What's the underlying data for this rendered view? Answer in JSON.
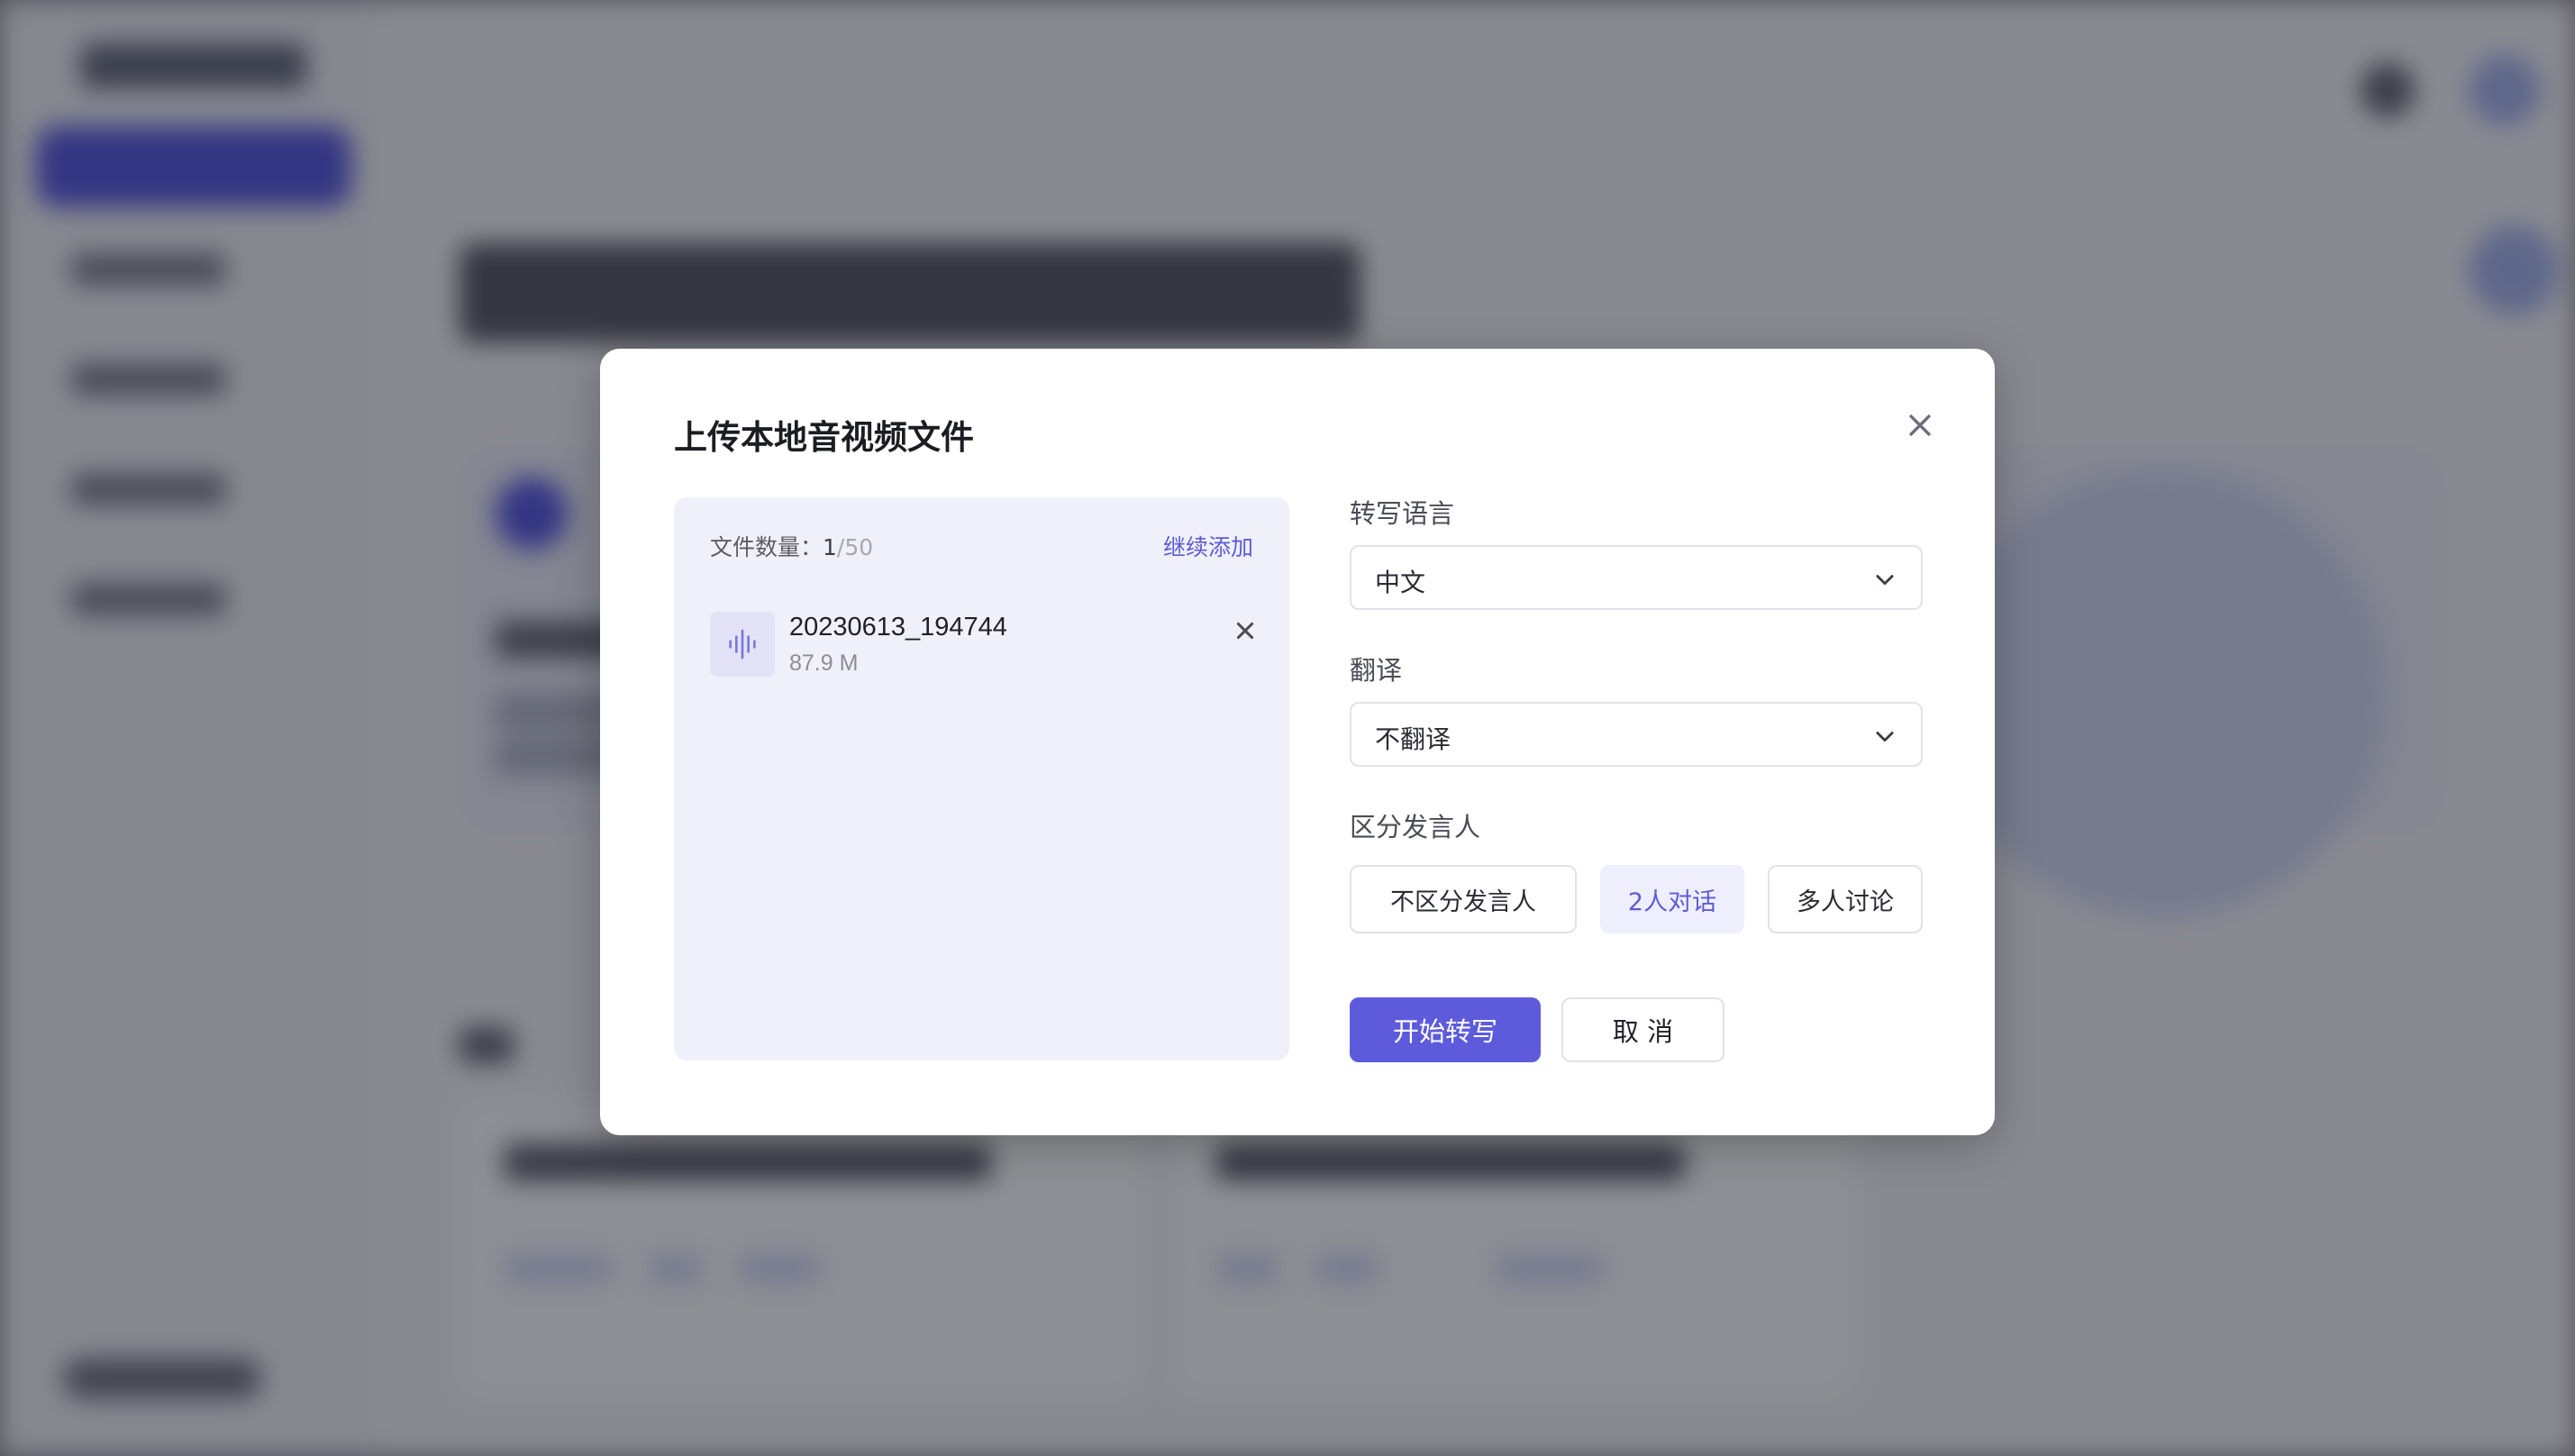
{
  "modal": {
    "title": "上传本地音视频文件",
    "close_icon": "close-icon"
  },
  "files": {
    "count_label": "文件数量：",
    "count_current": "1",
    "count_max": "/50",
    "add_more": "继续添加",
    "items": [
      {
        "name": "20230613_194744",
        "size": "87.9 M",
        "icon": "audio-wave-icon"
      }
    ]
  },
  "settings": {
    "language": {
      "label": "转写语言",
      "value": "中文"
    },
    "translation": {
      "label": "翻译",
      "value": "不翻译"
    },
    "speaker": {
      "label": "区分发言人",
      "options": [
        "不区分发言人",
        "2人对话",
        "多人讨论"
      ],
      "selected": "2人对话"
    }
  },
  "actions": {
    "start": "开始转写",
    "cancel": "取 消"
  },
  "colors": {
    "accent": "#5d5bdb",
    "panel_bg": "#f0f0fb",
    "overlay": "#3c3e46"
  }
}
